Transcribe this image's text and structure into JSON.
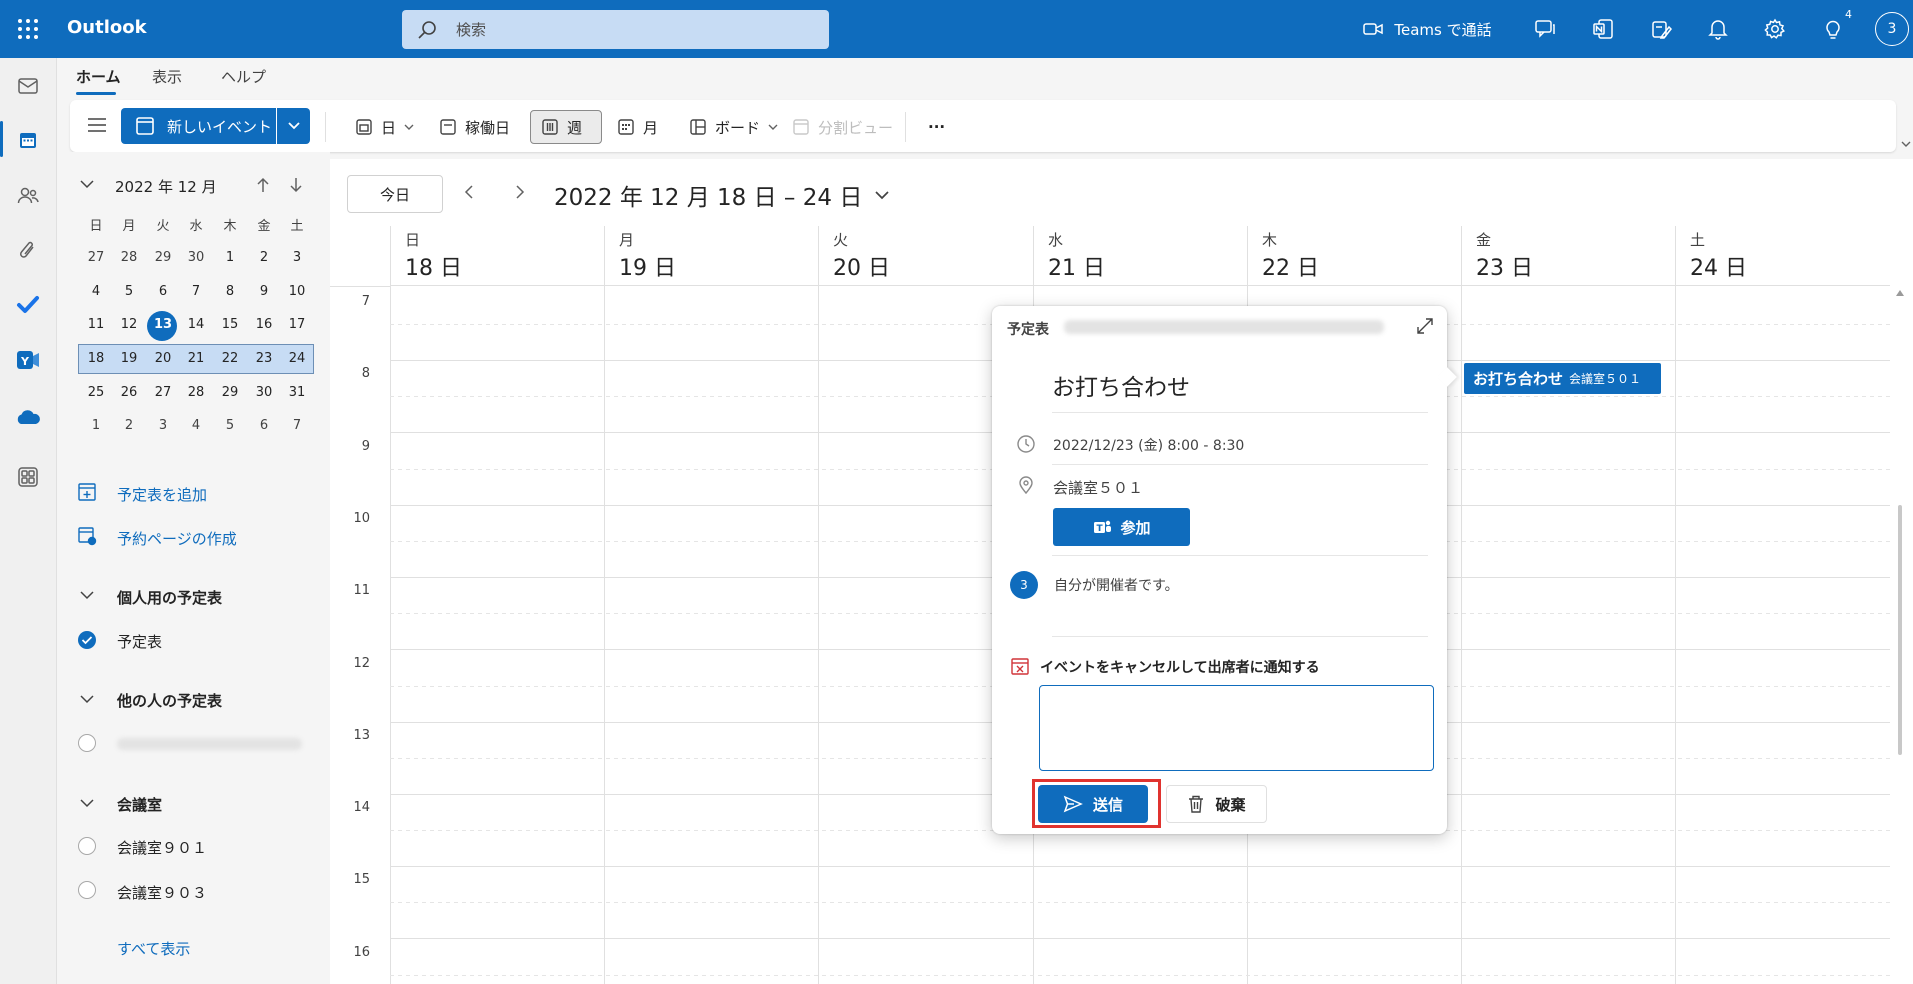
{
  "app": {
    "name": "Outlook"
  },
  "search": {
    "placeholder": "検索"
  },
  "topbar": {
    "teams_call_label": "Teams で通話",
    "tips_badge": "4",
    "avatar_initial": "3"
  },
  "ribbon": {
    "tabs": [
      "ホーム",
      "表示",
      "ヘルプ"
    ],
    "new_event_label": "新しいイベント",
    "views": {
      "day": "日",
      "work_week": "稼働日",
      "week": "週",
      "month": "月",
      "board": "ボード",
      "split_view": "分割ビュー"
    },
    "more": "···"
  },
  "mini_calendar": {
    "title": "2022 年 12 月",
    "weekdays": [
      "日",
      "月",
      "火",
      "水",
      "木",
      "金",
      "土"
    ],
    "rows": [
      [
        "27",
        "28",
        "29",
        "30",
        "1",
        "2",
        "3"
      ],
      [
        "4",
        "5",
        "6",
        "7",
        "8",
        "9",
        "10"
      ],
      [
        "11",
        "12",
        "13",
        "14",
        "15",
        "16",
        "17"
      ],
      [
        "18",
        "19",
        "20",
        "21",
        "22",
        "23",
        "24"
      ],
      [
        "25",
        "26",
        "27",
        "28",
        "29",
        "30",
        "31"
      ],
      [
        "1",
        "2",
        "3",
        "4",
        "5",
        "6",
        "7"
      ]
    ],
    "today": "13"
  },
  "sidebar": {
    "add_calendar": "予定表を追加",
    "booking_page": "予約ページの作成",
    "my_calendars_section": "個人用の予定表",
    "my_calendar": "予定表",
    "others_section": "他の人の予定表",
    "rooms_section": "会議室",
    "room_901": "会議室９０１",
    "room_903": "会議室９０３",
    "show_all": "すべて表示"
  },
  "calendar": {
    "today_button": "今日",
    "range_title": "2022 年 12 月 18 日 – 24 日",
    "days": [
      {
        "weekday": "日",
        "date": "18 日"
      },
      {
        "weekday": "月",
        "date": "19 日"
      },
      {
        "weekday": "火",
        "date": "20 日"
      },
      {
        "weekday": "水",
        "date": "21 日"
      },
      {
        "weekday": "木",
        "date": "22 日"
      },
      {
        "weekday": "金",
        "date": "23 日"
      },
      {
        "weekday": "土",
        "date": "24 日"
      }
    ],
    "hours": [
      "7",
      "8",
      "9",
      "10",
      "11",
      "12",
      "13",
      "14",
      "15",
      "16"
    ]
  },
  "event": {
    "title": "お打ち合わせ",
    "location": "会議室５０１"
  },
  "popup": {
    "calendar_label": "予定表",
    "title": "お打ち合わせ",
    "time": "2022/12/23 (金) 8:00 - 8:30",
    "location": "会議室５０１",
    "join_label": "参加",
    "organizer_avatar": "3",
    "organizer_text": "自分が開催者です。",
    "cancel_label": "イベントをキャンセルして出席者に通知する",
    "send_label": "送信",
    "discard_label": "破棄"
  },
  "colors": {
    "brand": "#0f6cbd",
    "highlight_frame": "#e0332f"
  }
}
